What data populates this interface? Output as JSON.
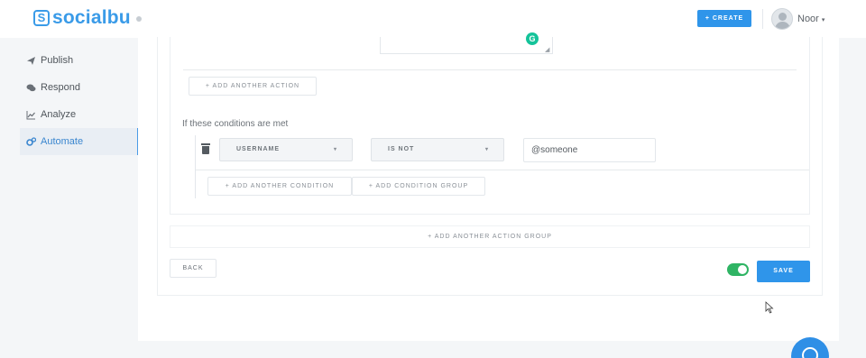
{
  "app": {
    "brand": "socialbu"
  },
  "header": {
    "create_label": "+ CREATE",
    "user_name": "Noor",
    "user_caret": "▾"
  },
  "sidebar": {
    "items": [
      {
        "label": "Publish",
        "icon": "paper-plane-icon",
        "active": false
      },
      {
        "label": "Respond",
        "icon": "chat-icon",
        "active": false
      },
      {
        "label": "Analyze",
        "icon": "line-chart-icon",
        "active": false
      },
      {
        "label": "Automate",
        "icon": "gears-icon",
        "active": true
      }
    ]
  },
  "editor": {
    "add_another_action": "+ ADD ANOTHER ACTION",
    "conditions_label": "If these conditions are met",
    "condition": {
      "field": "USERNAME",
      "operator": "IS NOT",
      "value": "@someone",
      "caret": "▾"
    },
    "add_another_condition": "+ ADD ANOTHER CONDITION",
    "add_condition_group": "+ ADD CONDITION GROUP",
    "add_another_action_group": "+ ADD ANOTHER ACTION GROUP"
  },
  "footer_actions": {
    "back_label": "BACK",
    "enabled": true,
    "save_label": "SAVE"
  },
  "colors": {
    "brand": "#3a9be8",
    "primary_button": "#2f95ea",
    "toggle_on": "#2fb464",
    "active_nav": "#3a86cf"
  }
}
